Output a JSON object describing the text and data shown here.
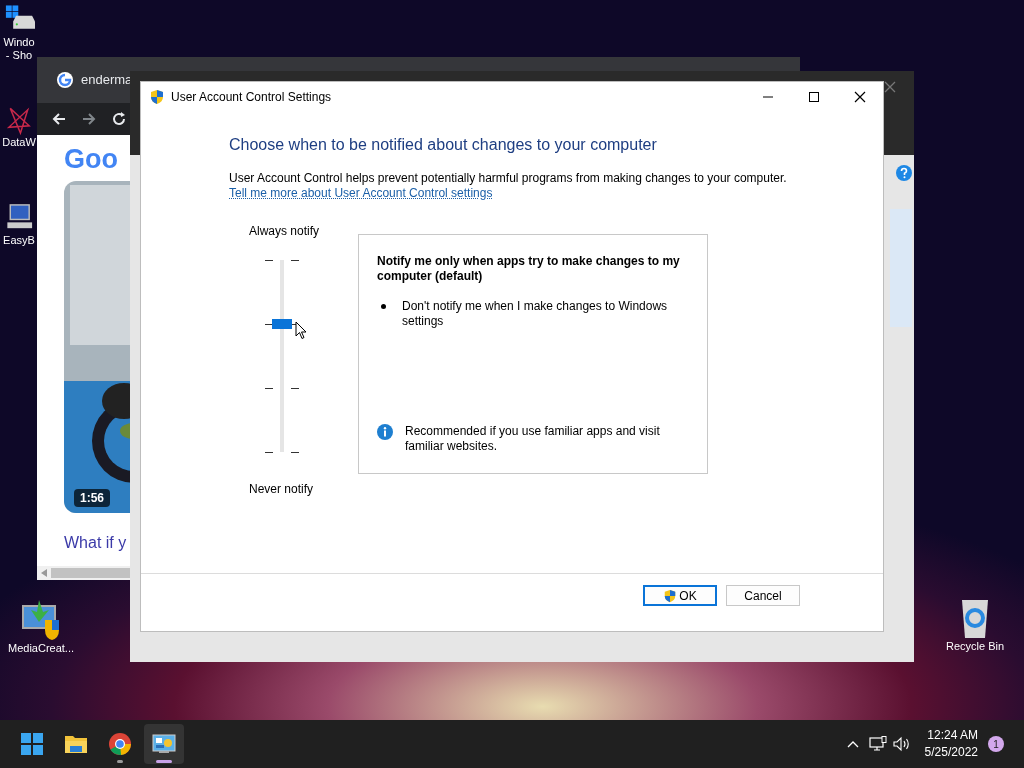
{
  "desktop_icons": [
    {
      "label": "Windo - Sho",
      "kind": "drive"
    },
    {
      "label": "DataW",
      "kind": "star"
    },
    {
      "label": "EasyB",
      "kind": "computer"
    },
    {
      "label": "MediaCreat...",
      "kind": "installer"
    },
    {
      "label": "Recycle Bin",
      "kind": "recycle"
    }
  ],
  "browser": {
    "tab_title": "enderma",
    "logo_text": "Goo",
    "video_duration": "1:56",
    "video_caption": "What if y"
  },
  "dialog": {
    "title": "User Account Control Settings",
    "heading": "Choose when to be notified about changes to your computer",
    "description": "User Account Control helps prevent potentially harmful programs from making changes to your computer.",
    "link": "Tell me more about User Account Control settings",
    "slider": {
      "top_label": "Always notify",
      "bottom_label": "Never notify",
      "level": 0.667
    },
    "info": {
      "title": "Notify me only when apps try to make changes to my computer (default)",
      "bullets": [
        "Don't notify me when I make changes to Windows settings"
      ],
      "note": "Recommended if you use familiar apps and visit familiar websites."
    },
    "buttons": [
      {
        "label": "OK",
        "kind": "shield",
        "focused": true
      },
      {
        "label": "Cancel",
        "kind": "plain",
        "focused": false
      }
    ]
  },
  "taskbar": {
    "apps": [
      {
        "kind": "start",
        "running": false,
        "active": false
      },
      {
        "kind": "folder",
        "running": false,
        "active": false
      },
      {
        "kind": "chrome",
        "running": true,
        "active": false
      },
      {
        "kind": "control-panel",
        "running": true,
        "active": true
      }
    ],
    "time": "12:24 AM",
    "date": "5/25/2022",
    "notification_count": "1"
  }
}
